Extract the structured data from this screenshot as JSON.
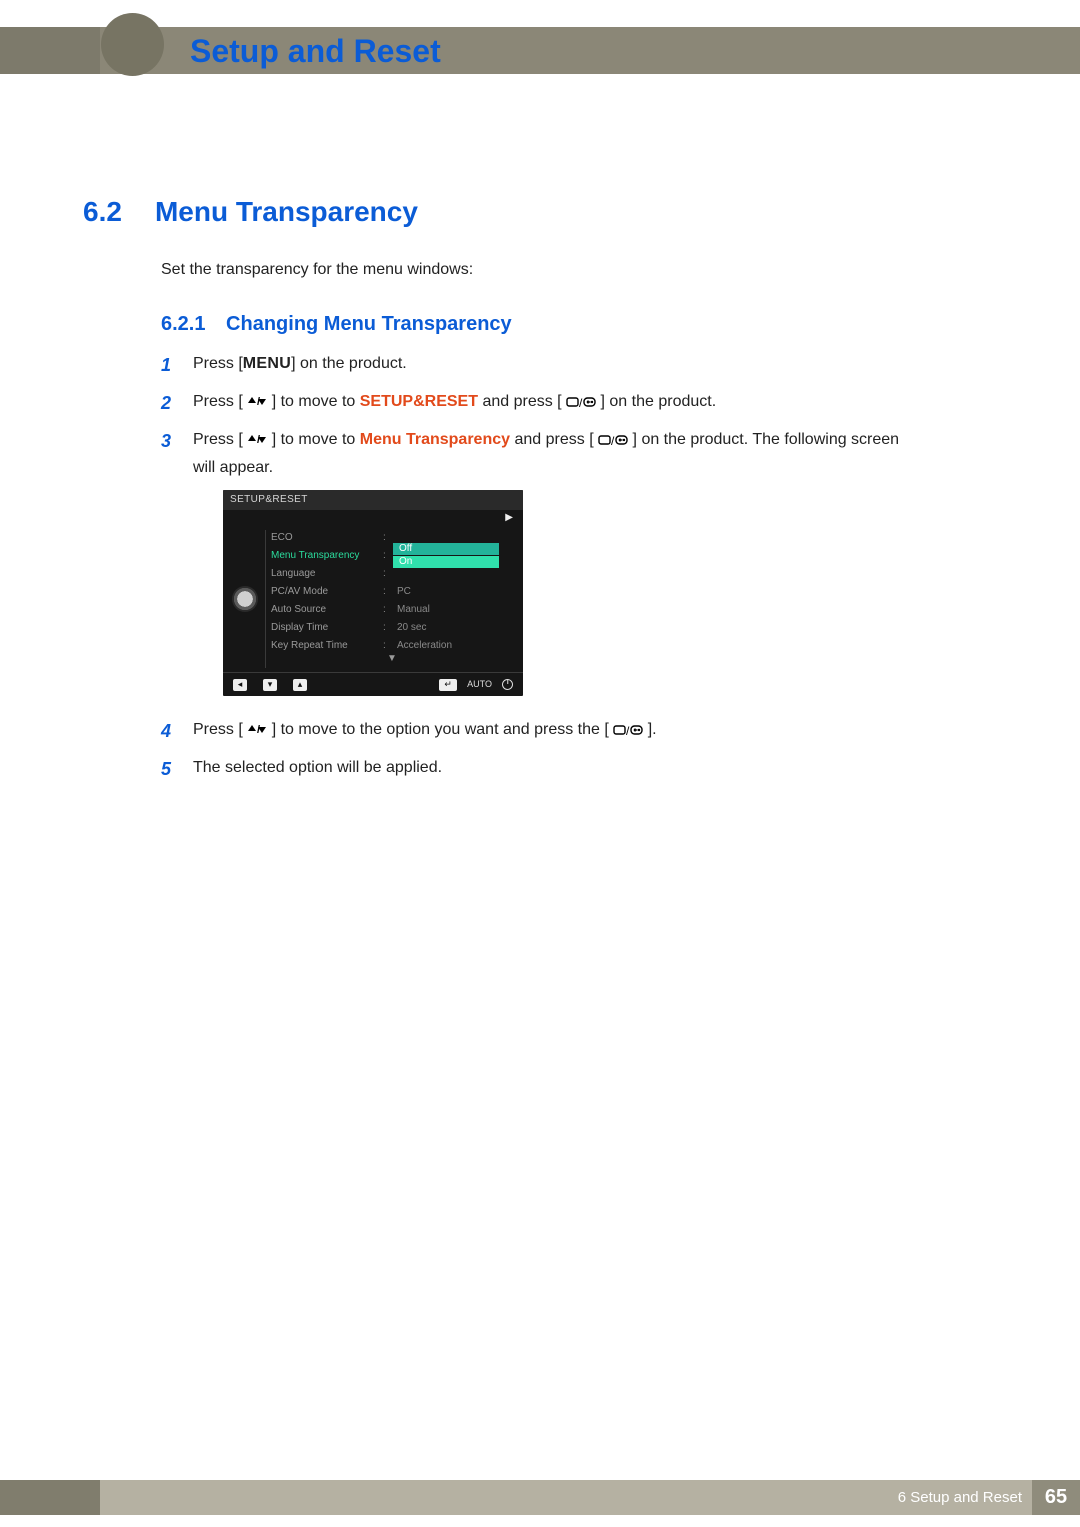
{
  "header": {
    "title": "Setup and Reset"
  },
  "section": {
    "number": "6.2",
    "title": "Menu Transparency",
    "intro": "Set the transparency for the menu windows:"
  },
  "subsection": {
    "number": "6.2.1",
    "title": "Changing Menu Transparency"
  },
  "steps": {
    "s1": {
      "num": "1",
      "pre": "Press [",
      "menu": "MENU",
      "post": "] on the product."
    },
    "s2": {
      "num": "2",
      "a": "Press [",
      "b": "] to move to ",
      "dest": "SETUP&RESET",
      "c": " and press [",
      "d": "] on the product."
    },
    "s3": {
      "num": "3",
      "a": "Press [",
      "b": "] to move to ",
      "dest": "Menu Transparency",
      "c": " and press [",
      "d": "] on the product. The following screen will appear."
    },
    "s4": {
      "num": "4",
      "a": "Press [",
      "b": "] to move to the option you want and press the [",
      "c": "]."
    },
    "s5": {
      "num": "5",
      "txt": "The selected option will be applied."
    }
  },
  "osd": {
    "title": "SETUP&RESET",
    "arrow_right": "▶",
    "rows": [
      {
        "label": "ECO",
        "value": ""
      },
      {
        "label": "Menu Transparency",
        "value": "",
        "active": true,
        "options": [
          "Off",
          "On"
        ],
        "highlight_index": 1
      },
      {
        "label": "Language",
        "value": ""
      },
      {
        "label": "PC/AV Mode",
        "value": "PC"
      },
      {
        "label": "Auto Source",
        "value": "Manual"
      },
      {
        "label": "Display Time",
        "value": "20 sec"
      },
      {
        "label": "Key Repeat Time",
        "value": "Acceleration"
      }
    ],
    "footer_auto": "AUTO"
  },
  "footer": {
    "chapter_prefix": "6",
    "chapter_title": " Setup and Reset",
    "page": "65"
  }
}
